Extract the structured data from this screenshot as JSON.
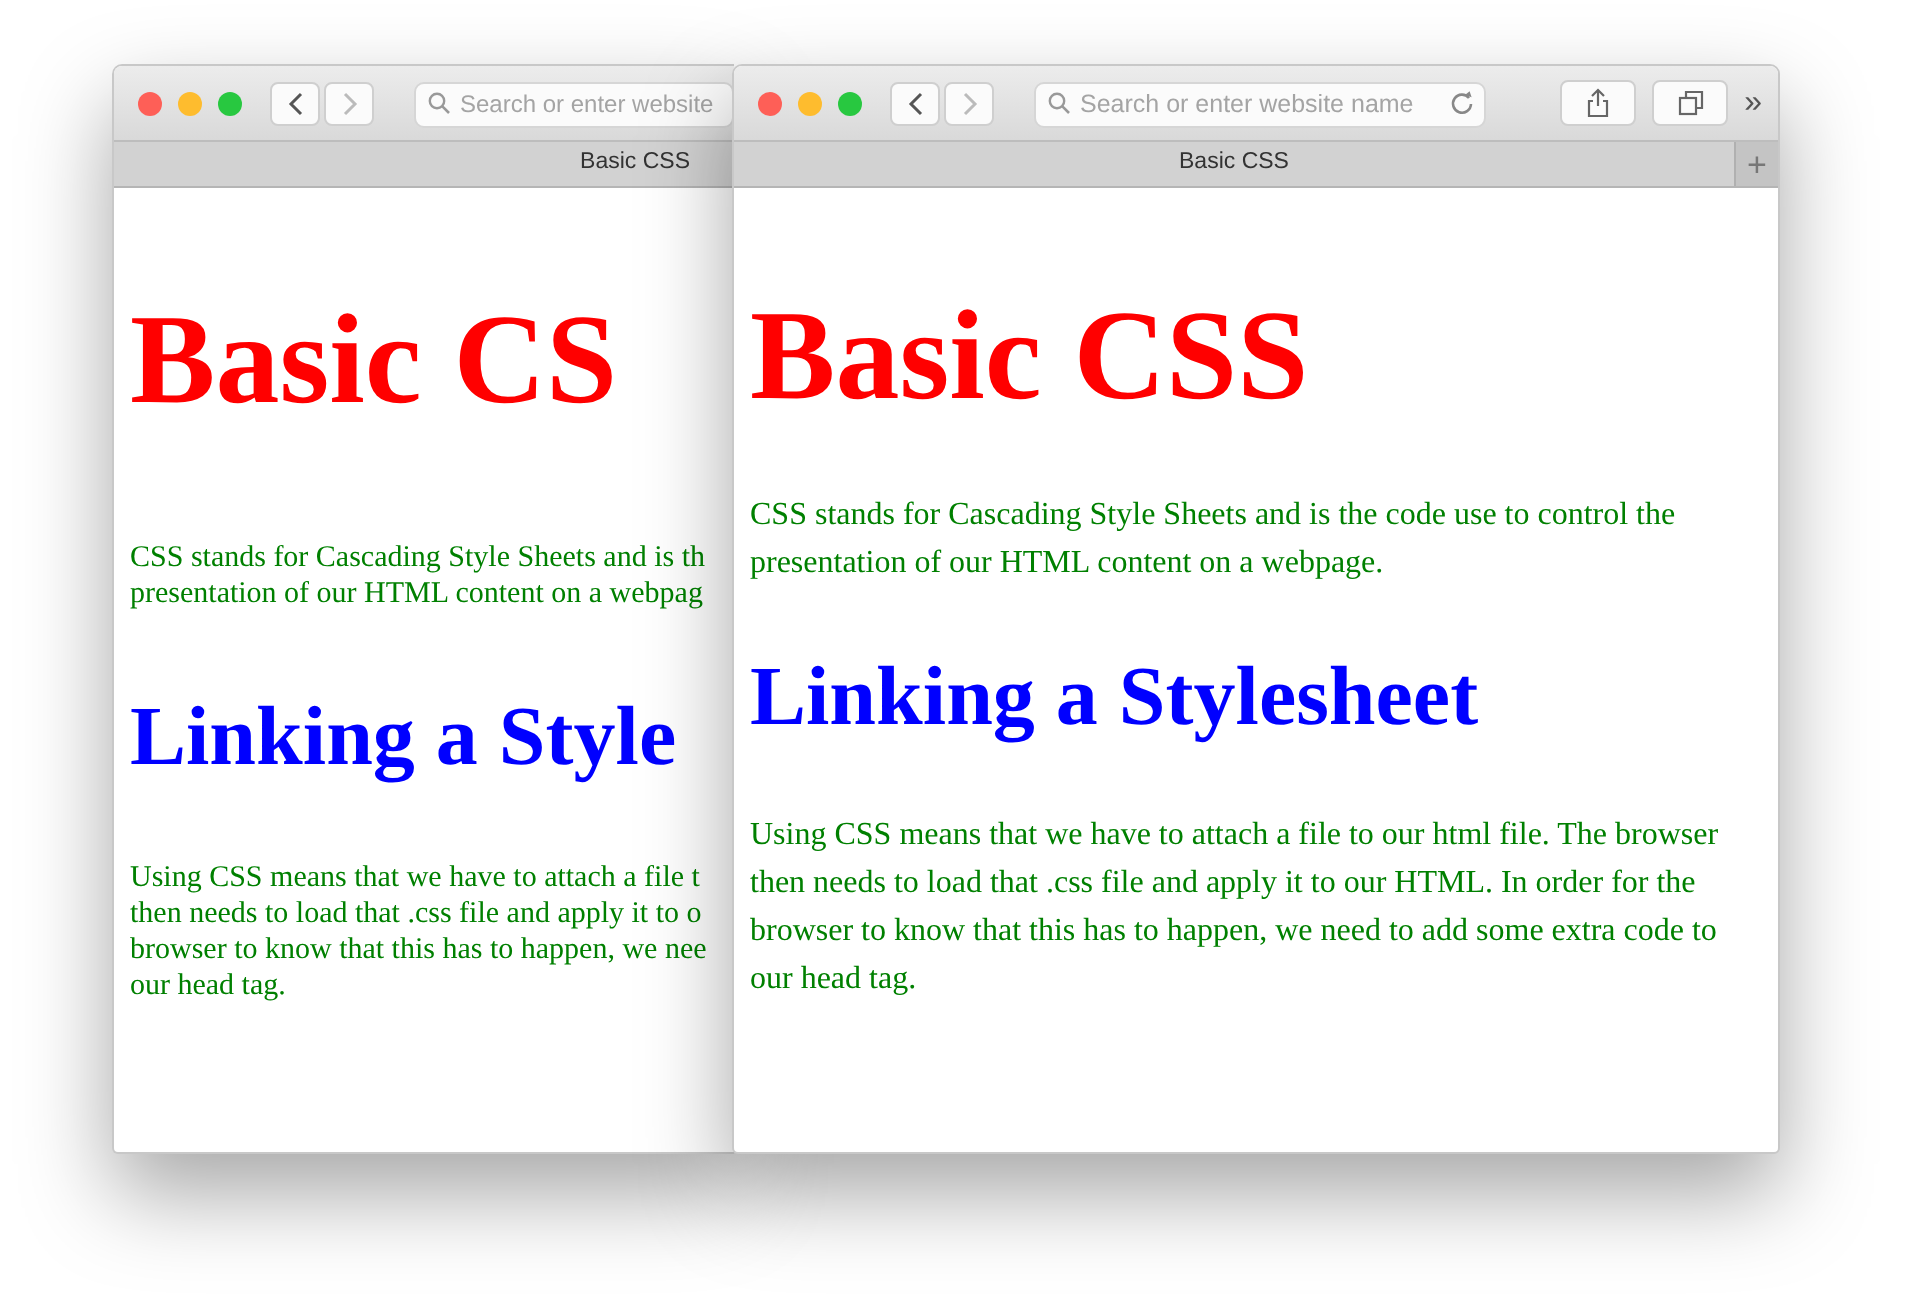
{
  "windows": [
    {
      "front": false,
      "address": {
        "placeholder": "Search or enter website"
      },
      "tab_title": "Basic CSS",
      "content": [
        {
          "kind": "h1",
          "color": "#ff0000",
          "lines": [
            "Basic CS"
          ]
        },
        {
          "kind": "p",
          "color": "#008000",
          "lines": [
            "CSS stands for Cascading Style Sheets and is th",
            "presentation of our HTML content on a webpag"
          ]
        },
        {
          "kind": "h2",
          "color": "#0000ff",
          "lines": [
            "Linking a Style"
          ]
        },
        {
          "kind": "p",
          "color": "#008000",
          "lines": [
            "Using CSS means that we have to attach a file t",
            "then needs to load that .css file and apply it to o",
            "browser to know that this has to happen, we nee",
            "our head tag."
          ]
        }
      ]
    },
    {
      "front": true,
      "address": {
        "placeholder": "Search or enter website name"
      },
      "overflow": "»",
      "tab_title": "Basic CSS",
      "new_tab": "+",
      "content": [
        {
          "kind": "h1",
          "color": "#ff0000",
          "lines": [
            "Basic CSS"
          ]
        },
        {
          "kind": "p",
          "color": "#008000",
          "lines": [
            "CSS stands for Cascading Style Sheets and is the code use to control the presentation of our HTML content on a webpage."
          ]
        },
        {
          "kind": "h2",
          "color": "#0000ff",
          "lines": [
            "Linking a Stylesheet"
          ]
        },
        {
          "kind": "p",
          "color": "#008000",
          "lines": [
            "Using CSS means that we have to attach a file to our html file. The browser then needs to load that .css file and apply it to our HTML. In order for the browser to know that this has to happen, we need to add some extra code to our head tag."
          ]
        }
      ]
    }
  ]
}
